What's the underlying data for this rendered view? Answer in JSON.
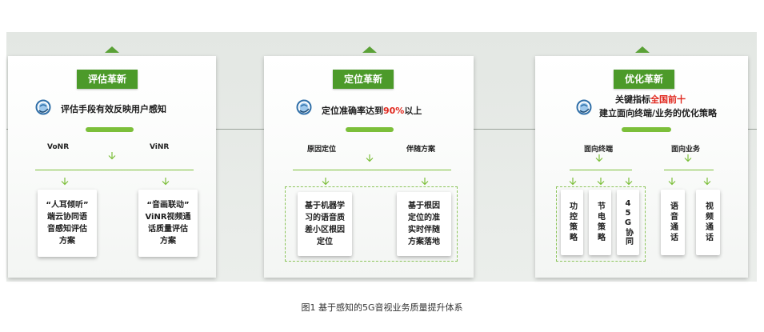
{
  "colors": {
    "accent": "#4c9a2a",
    "connector": "#7cbf3a",
    "highlight": "#e0281e"
  },
  "icon": "globe-icon",
  "panels": [
    {
      "title": "评估革新",
      "headline": "评估手段有效反映用户感知",
      "branches": [
        "VoNR",
        "ViNR"
      ],
      "cards": [
        "“人耳倾听”\n端云协同语\n音感知评估\n方案",
        "“音画联动”\nViNR视频通\n话质量评估\n方案"
      ]
    },
    {
      "title": "定位革新",
      "headline_pre": "定位准确率达到",
      "headline_highlight": "90%",
      "headline_post": "以上",
      "branches": [
        "原因定位",
        "伴随方案"
      ],
      "cards": [
        "基于机器学\n习的语音质\n差小区根因\n定位",
        "基于根因\n定位的准\n实时伴随\n方案落地"
      ]
    },
    {
      "title": "优化革新",
      "headline_line1_pre": "关键指标",
      "headline_line1_highlight": "全国前十",
      "headline_line2": "建立面向终端/业务的优化策略",
      "branches": [
        "面向终端",
        "面向业务"
      ],
      "cards": [
        "功控策略",
        "节电策略",
        "45G协同",
        "语音通话",
        "视频通话"
      ]
    }
  ],
  "caption": "图1  基于感知的5G音视业务质量提升体系"
}
